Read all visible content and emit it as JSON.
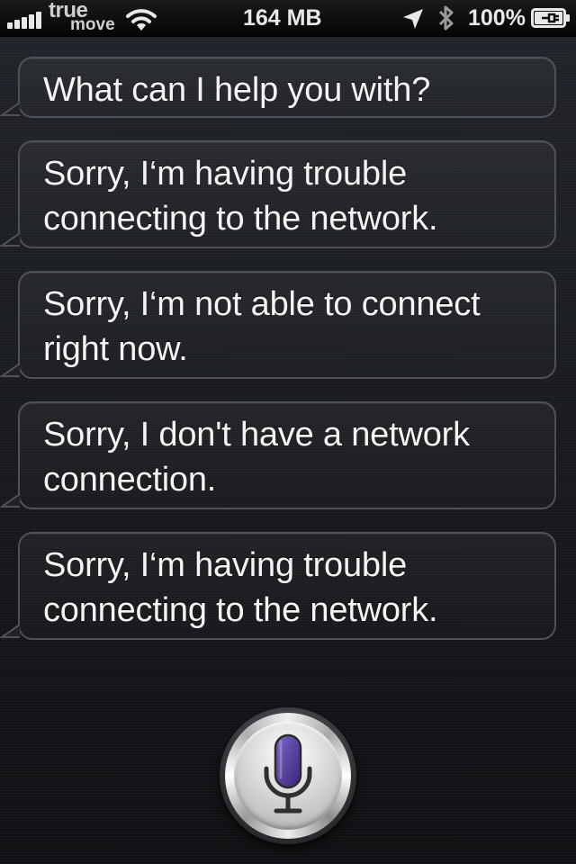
{
  "status_bar": {
    "carrier_line1": "true",
    "carrier_line2": "move",
    "memory": "164 MB",
    "battery": "100%",
    "icons": [
      "signal-bars-icon",
      "wifi-icon",
      "location-arrow-icon",
      "bluetooth-icon",
      "battery-charging-icon"
    ]
  },
  "conversation": {
    "messages": [
      {
        "text": "What can I help you with?"
      },
      {
        "text": "Sorry, I‘m having trouble connecting to the network."
      },
      {
        "text": "Sorry, I‘m not able to connect right now."
      },
      {
        "text": "Sorry, I don't have a network connection."
      },
      {
        "text": "Sorry, I‘m having trouble connecting to the network."
      }
    ]
  },
  "mic": {
    "icon": "microphone-icon",
    "accent_color": "#5a3fa0"
  }
}
